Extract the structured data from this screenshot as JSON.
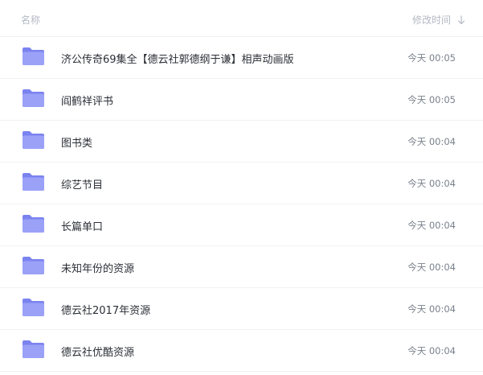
{
  "header": {
    "name_label": "名称",
    "time_label": "修改时间"
  },
  "folders": [
    {
      "name": "济公传奇69集全【德云社郭德纲于谦】相声动画版",
      "time": "今天 00:05",
      "icon": "folder-icon"
    },
    {
      "name": "阎鹤祥评书",
      "time": "今天 00:05",
      "icon": "folder-icon"
    },
    {
      "name": "图书类",
      "time": "今天 00:04",
      "icon": "folder-icon"
    },
    {
      "name": "综艺节目",
      "time": "今天 00:04",
      "icon": "folder-icon"
    },
    {
      "name": "长篇单口",
      "time": "今天 00:04",
      "icon": "folder-icon"
    },
    {
      "name": "未知年份的资源",
      "time": "今天 00:04",
      "icon": "folder-icon"
    },
    {
      "name": "德云社2017年资源",
      "time": "今天 00:04",
      "icon": "folder-icon"
    },
    {
      "name": "德云社优酷资源",
      "time": "今天 00:04",
      "icon": "folder-icon"
    }
  ],
  "colors": {
    "folder_back": "#7b83f0",
    "folder_front": "#9aa1f7",
    "header_text": "#b3b9c4",
    "name_text": "#2b2f36",
    "time_text": "#7a818c"
  }
}
